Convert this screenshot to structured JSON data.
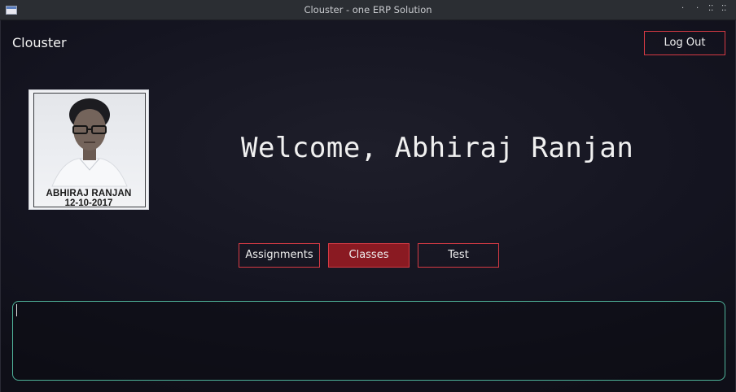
{
  "window": {
    "title": "Clouster - one ERP Solution",
    "controls": [
      "·",
      "·",
      "⁚⁚",
      "⁚⁚"
    ]
  },
  "header": {
    "brand": "Clouster",
    "logout_label": "Log Out"
  },
  "profile": {
    "photo_name": "ABHIRAJ RANJAN",
    "photo_date": "12-10-2017"
  },
  "welcome": {
    "text": "Welcome, Abhiraj Ranjan"
  },
  "nav": {
    "assignments": "Assignments",
    "classes": "Classes",
    "test": "Test",
    "active": "classes"
  },
  "content": {
    "value": ""
  },
  "colors": {
    "accent_border": "#d63a44",
    "active_fill": "#8a1a22",
    "text_box_border": "#4fb39a",
    "background": "#141420"
  }
}
